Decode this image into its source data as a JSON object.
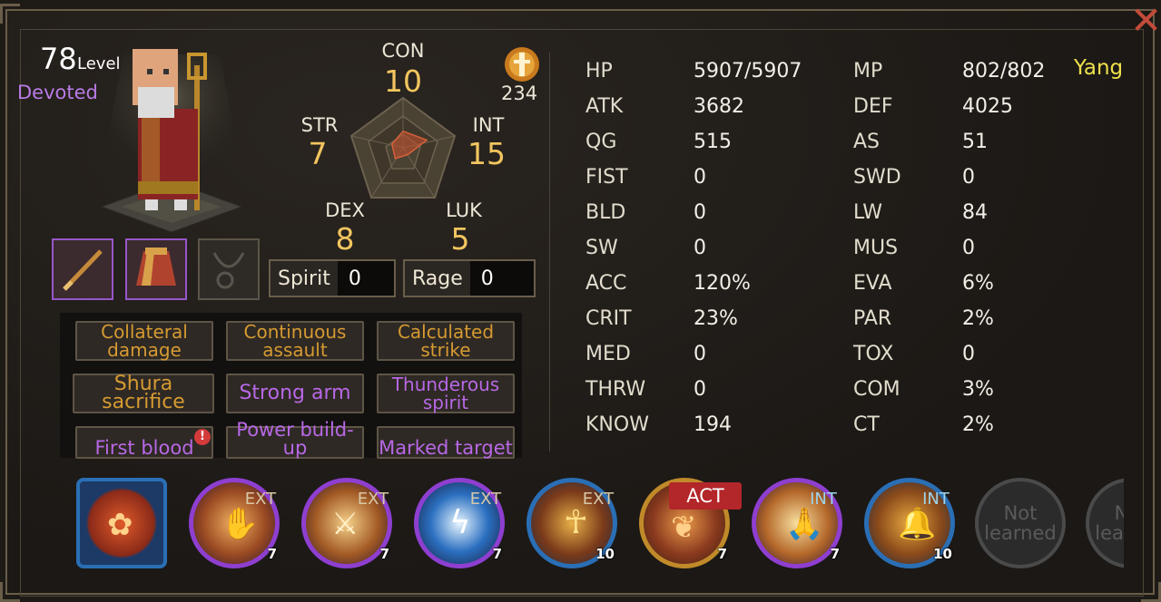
{
  "character": {
    "level": "78",
    "level_label": "Level",
    "title": "Devoted"
  },
  "attributes": {
    "con": {
      "label": "CON",
      "value": "10"
    },
    "str": {
      "label": "STR",
      "value": "7"
    },
    "int": {
      "label": "INT",
      "value": "15"
    },
    "dex": {
      "label": "DEX",
      "value": "8"
    },
    "luk": {
      "label": "LUK",
      "value": "5"
    }
  },
  "currency": {
    "count": "234",
    "icon": "ingot-icon"
  },
  "resources": {
    "spirit": {
      "label": "Spirit",
      "value": "0"
    },
    "rage": {
      "label": "Rage",
      "value": "0"
    }
  },
  "equipment": [
    {
      "icon": "staff-icon",
      "state": "equipped"
    },
    {
      "icon": "robe-icon",
      "state": "equipped"
    },
    {
      "icon": "necklace-icon",
      "state": "empty"
    }
  ],
  "traits": [
    {
      "label": "Collateral damage",
      "color": "gold"
    },
    {
      "label": "Continuous assault",
      "color": "gold"
    },
    {
      "label": "Calculated strike",
      "color": "gold"
    },
    {
      "label": "Shura sacrifice",
      "color": "gold"
    },
    {
      "label": "Strong arm",
      "color": "purple"
    },
    {
      "label": "Thunderous spirit",
      "color": "purple"
    },
    {
      "label": "First blood",
      "color": "purple",
      "alert": "!"
    },
    {
      "label": "Power build-up",
      "color": "purple"
    },
    {
      "label": "Marked target",
      "color": "purple"
    }
  ],
  "stats_left": [
    {
      "name": "HP",
      "value": "5907/5907"
    },
    {
      "name": "ATK",
      "value": "3682"
    },
    {
      "name": "QG",
      "value": "515"
    },
    {
      "name": "FIST",
      "value": "0"
    },
    {
      "name": "BLD",
      "value": "0"
    },
    {
      "name": "SW",
      "value": "0"
    },
    {
      "name": "ACC",
      "value": "120%"
    },
    {
      "name": "CRIT",
      "value": "23%"
    },
    {
      "name": "MED",
      "value": "0"
    },
    {
      "name": "THRW",
      "value": "0"
    },
    {
      "name": "KNOW",
      "value": "194"
    }
  ],
  "stats_right": [
    {
      "name": "MP",
      "value": "802/802"
    },
    {
      "name": "DEF",
      "value": "4025"
    },
    {
      "name": "AS",
      "value": "51"
    },
    {
      "name": "SWD",
      "value": "0"
    },
    {
      "name": "LW",
      "value": "84"
    },
    {
      "name": "MUS",
      "value": "0"
    },
    {
      "name": "EVA",
      "value": "6%"
    },
    {
      "name": "PAR",
      "value": "2%"
    },
    {
      "name": "TOX",
      "value": "0"
    },
    {
      "name": "COM",
      "value": "3%"
    },
    {
      "name": "CT",
      "value": "2%"
    }
  ],
  "alignment": "Yang",
  "skills": [
    {
      "icon": "lotus-flame-icon",
      "tag": "",
      "level": ""
    },
    {
      "icon": "palm-strike-icon",
      "tag": "EXT",
      "level": "7"
    },
    {
      "icon": "twin-blades-icon",
      "tag": "EXT",
      "level": "7"
    },
    {
      "icon": "lightning-figure-icon",
      "tag": "EXT",
      "level": "7"
    },
    {
      "icon": "golden-staff-icon",
      "tag": "EXT",
      "level": "10"
    },
    {
      "icon": "phoenix-icon",
      "tag": "ACT",
      "level": "7"
    },
    {
      "icon": "praying-hands-icon",
      "tag": "INT",
      "level": "7"
    },
    {
      "icon": "bell-icon",
      "tag": "INT",
      "level": "10"
    },
    {
      "icon": "locked-skill-icon",
      "tag": "",
      "level": "",
      "text": "Not learned"
    },
    {
      "icon": "locked-skill-icon",
      "tag": "",
      "level": "",
      "text": "Not learned"
    }
  ],
  "colors": {
    "gold_value": "#f2c55f",
    "purple": "#b868e6",
    "trait_gold": "#d69a32",
    "yang": "#efe04c",
    "act_red": "#b3262a"
  }
}
